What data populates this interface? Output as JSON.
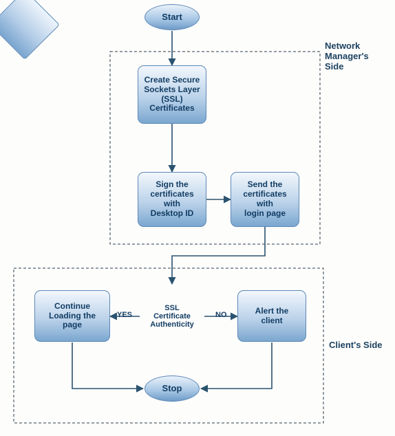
{
  "chart_data": {
    "type": "flowchart",
    "title": "",
    "swimlanes": [
      {
        "id": "nm",
        "name": "Network Manager's Side"
      },
      {
        "id": "client",
        "name": "Client's Side"
      }
    ],
    "nodes": [
      {
        "id": "start",
        "type": "terminator",
        "label": "Start",
        "lane": null
      },
      {
        "id": "create",
        "type": "process",
        "label": "Create Secure Sockets Layer (SSL) Certificates",
        "lane": "nm"
      },
      {
        "id": "sign",
        "type": "process",
        "label": "Sign the certificates with Desktop ID",
        "lane": "nm"
      },
      {
        "id": "send",
        "type": "process",
        "label": "Send the certificates with login page",
        "lane": "nm"
      },
      {
        "id": "auth",
        "type": "decision",
        "label": "SSL Certificate Authenticity",
        "lane": "client"
      },
      {
        "id": "cont",
        "type": "process",
        "label": "Continue Loading the page",
        "lane": "client"
      },
      {
        "id": "alert",
        "type": "process",
        "label": "Alert the client",
        "lane": "client"
      },
      {
        "id": "stop",
        "type": "terminator",
        "label": "Stop",
        "lane": "client"
      }
    ],
    "edges": [
      {
        "from": "start",
        "to": "create",
        "label": ""
      },
      {
        "from": "create",
        "to": "sign",
        "label": ""
      },
      {
        "from": "sign",
        "to": "send",
        "label": ""
      },
      {
        "from": "send",
        "to": "auth",
        "label": ""
      },
      {
        "from": "auth",
        "to": "cont",
        "label": "YES"
      },
      {
        "from": "auth",
        "to": "alert",
        "label": "NO"
      },
      {
        "from": "cont",
        "to": "stop",
        "label": ""
      },
      {
        "from": "alert",
        "to": "stop",
        "label": ""
      }
    ]
  },
  "frames": {
    "nm": "Network Manager's\nSide",
    "client": "Client's Side"
  },
  "labels": {
    "start": "Start",
    "create": "Create Secure\nSockets Layer\n(SSL)\nCertificates",
    "sign": "Sign the\ncertificates\nwith\nDesktop ID",
    "send": "Send the\ncertificates\nwith\nlogin page",
    "auth": "SSL\nCertificate\nAuthenticity",
    "cont": "Continue\nLoading the\npage",
    "alert": "Alert the\nclient",
    "stop": "Stop",
    "yes": "YES",
    "no": "NO"
  }
}
